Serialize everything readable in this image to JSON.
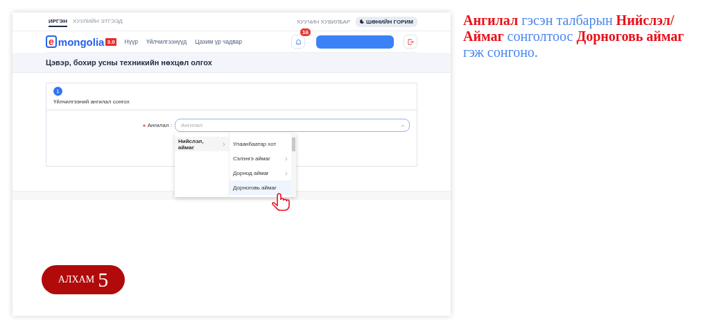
{
  "top_bar": {
    "tabs": [
      {
        "label": "ИРГЭН",
        "selected": true
      },
      {
        "label": "ХУУЛИЙН ЭТГЭЭД",
        "selected": false
      }
    ],
    "old_version": "ХУУЧИН ХУВИЛБАР",
    "dark_mode": "ШӨНИЙН ГОРИМ"
  },
  "header": {
    "logo": "mongolia",
    "logo_letter": "e",
    "logo_version": "3.0",
    "nav": [
      "Нүүр",
      "Үйлчилгээнүүд",
      "Цахим үр чадвар"
    ],
    "notification_count": "16"
  },
  "page_title": "Цэвэр, бохир усны техникийн нөхцөл олгох",
  "form": {
    "step_number": "1",
    "step_title": "Үйлчилгээний ангилал сонгох",
    "field": {
      "label": "Ангилал :",
      "required": true,
      "placeholder": "Ангилал",
      "expanded": true
    }
  },
  "dropdown": {
    "level_1": [
      {
        "label": "Нийслэл, аймаг",
        "selected": true,
        "expandable": true
      }
    ],
    "level_2": [
      {
        "label": "Улаанбаатар хот",
        "expandable": false,
        "highlighted": false
      },
      {
        "label": "Сэлэнгэ аймаг",
        "expandable": true,
        "highlighted": false
      },
      {
        "label": "Дорнод аймаг",
        "expandable": true,
        "highlighted": false
      },
      {
        "label": "Дорноговь аймаг",
        "expandable": false,
        "highlighted": true
      }
    ]
  },
  "step_badge": {
    "word": "АЛХАМ",
    "number": "5"
  },
  "instruction": [
    {
      "text": "Ангилал",
      "highlight": true
    },
    {
      "text": " гэсэн талбарын ",
      "highlight": false
    },
    {
      "text": "Нийслэл/ Аймаг",
      "highlight": true
    },
    {
      "text": " сонголтоос ",
      "highlight": false
    },
    {
      "text": "Дорноговь аймаг",
      "highlight": true
    },
    {
      "text": " гэж сонгоно.",
      "highlight": false
    }
  ]
}
